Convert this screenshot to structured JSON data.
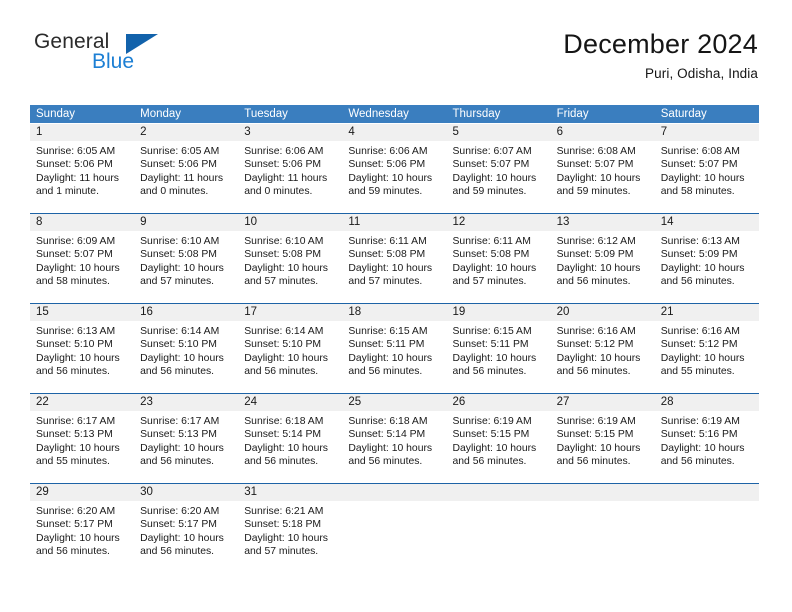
{
  "brand": {
    "name_part1": "General",
    "name_part2": "Blue",
    "triangle_color": "#1262ab",
    "blue_color": "#1c7fd4"
  },
  "header": {
    "month_title": "December 2024",
    "location": "Puri, Odisha, India"
  },
  "theme": {
    "header_blue": "#3a7ebf",
    "separator_blue": "#1d63a6",
    "daynum_band": "#f0f0f0"
  },
  "weekdays": [
    "Sunday",
    "Monday",
    "Tuesday",
    "Wednesday",
    "Thursday",
    "Friday",
    "Saturday"
  ],
  "weeks": [
    [
      {
        "day": "1",
        "sunrise": "Sunrise: 6:05 AM",
        "sunset": "Sunset: 5:06 PM",
        "daylight1": "Daylight: 11 hours",
        "daylight2": "and 1 minute."
      },
      {
        "day": "2",
        "sunrise": "Sunrise: 6:05 AM",
        "sunset": "Sunset: 5:06 PM",
        "daylight1": "Daylight: 11 hours",
        "daylight2": "and 0 minutes."
      },
      {
        "day": "3",
        "sunrise": "Sunrise: 6:06 AM",
        "sunset": "Sunset: 5:06 PM",
        "daylight1": "Daylight: 11 hours",
        "daylight2": "and 0 minutes."
      },
      {
        "day": "4",
        "sunrise": "Sunrise: 6:06 AM",
        "sunset": "Sunset: 5:06 PM",
        "daylight1": "Daylight: 10 hours",
        "daylight2": "and 59 minutes."
      },
      {
        "day": "5",
        "sunrise": "Sunrise: 6:07 AM",
        "sunset": "Sunset: 5:07 PM",
        "daylight1": "Daylight: 10 hours",
        "daylight2": "and 59 minutes."
      },
      {
        "day": "6",
        "sunrise": "Sunrise: 6:08 AM",
        "sunset": "Sunset: 5:07 PM",
        "daylight1": "Daylight: 10 hours",
        "daylight2": "and 59 minutes."
      },
      {
        "day": "7",
        "sunrise": "Sunrise: 6:08 AM",
        "sunset": "Sunset: 5:07 PM",
        "daylight1": "Daylight: 10 hours",
        "daylight2": "and 58 minutes."
      }
    ],
    [
      {
        "day": "8",
        "sunrise": "Sunrise: 6:09 AM",
        "sunset": "Sunset: 5:07 PM",
        "daylight1": "Daylight: 10 hours",
        "daylight2": "and 58 minutes."
      },
      {
        "day": "9",
        "sunrise": "Sunrise: 6:10 AM",
        "sunset": "Sunset: 5:08 PM",
        "daylight1": "Daylight: 10 hours",
        "daylight2": "and 57 minutes."
      },
      {
        "day": "10",
        "sunrise": "Sunrise: 6:10 AM",
        "sunset": "Sunset: 5:08 PM",
        "daylight1": "Daylight: 10 hours",
        "daylight2": "and 57 minutes."
      },
      {
        "day": "11",
        "sunrise": "Sunrise: 6:11 AM",
        "sunset": "Sunset: 5:08 PM",
        "daylight1": "Daylight: 10 hours",
        "daylight2": "and 57 minutes."
      },
      {
        "day": "12",
        "sunrise": "Sunrise: 6:11 AM",
        "sunset": "Sunset: 5:08 PM",
        "daylight1": "Daylight: 10 hours",
        "daylight2": "and 57 minutes."
      },
      {
        "day": "13",
        "sunrise": "Sunrise: 6:12 AM",
        "sunset": "Sunset: 5:09 PM",
        "daylight1": "Daylight: 10 hours",
        "daylight2": "and 56 minutes."
      },
      {
        "day": "14",
        "sunrise": "Sunrise: 6:13 AM",
        "sunset": "Sunset: 5:09 PM",
        "daylight1": "Daylight: 10 hours",
        "daylight2": "and 56 minutes."
      }
    ],
    [
      {
        "day": "15",
        "sunrise": "Sunrise: 6:13 AM",
        "sunset": "Sunset: 5:10 PM",
        "daylight1": "Daylight: 10 hours",
        "daylight2": "and 56 minutes."
      },
      {
        "day": "16",
        "sunrise": "Sunrise: 6:14 AM",
        "sunset": "Sunset: 5:10 PM",
        "daylight1": "Daylight: 10 hours",
        "daylight2": "and 56 minutes."
      },
      {
        "day": "17",
        "sunrise": "Sunrise: 6:14 AM",
        "sunset": "Sunset: 5:10 PM",
        "daylight1": "Daylight: 10 hours",
        "daylight2": "and 56 minutes."
      },
      {
        "day": "18",
        "sunrise": "Sunrise: 6:15 AM",
        "sunset": "Sunset: 5:11 PM",
        "daylight1": "Daylight: 10 hours",
        "daylight2": "and 56 minutes."
      },
      {
        "day": "19",
        "sunrise": "Sunrise: 6:15 AM",
        "sunset": "Sunset: 5:11 PM",
        "daylight1": "Daylight: 10 hours",
        "daylight2": "and 56 minutes."
      },
      {
        "day": "20",
        "sunrise": "Sunrise: 6:16 AM",
        "sunset": "Sunset: 5:12 PM",
        "daylight1": "Daylight: 10 hours",
        "daylight2": "and 56 minutes."
      },
      {
        "day": "21",
        "sunrise": "Sunrise: 6:16 AM",
        "sunset": "Sunset: 5:12 PM",
        "daylight1": "Daylight: 10 hours",
        "daylight2": "and 55 minutes."
      }
    ],
    [
      {
        "day": "22",
        "sunrise": "Sunrise: 6:17 AM",
        "sunset": "Sunset: 5:13 PM",
        "daylight1": "Daylight: 10 hours",
        "daylight2": "and 55 minutes."
      },
      {
        "day": "23",
        "sunrise": "Sunrise: 6:17 AM",
        "sunset": "Sunset: 5:13 PM",
        "daylight1": "Daylight: 10 hours",
        "daylight2": "and 56 minutes."
      },
      {
        "day": "24",
        "sunrise": "Sunrise: 6:18 AM",
        "sunset": "Sunset: 5:14 PM",
        "daylight1": "Daylight: 10 hours",
        "daylight2": "and 56 minutes."
      },
      {
        "day": "25",
        "sunrise": "Sunrise: 6:18 AM",
        "sunset": "Sunset: 5:14 PM",
        "daylight1": "Daylight: 10 hours",
        "daylight2": "and 56 minutes."
      },
      {
        "day": "26",
        "sunrise": "Sunrise: 6:19 AM",
        "sunset": "Sunset: 5:15 PM",
        "daylight1": "Daylight: 10 hours",
        "daylight2": "and 56 minutes."
      },
      {
        "day": "27",
        "sunrise": "Sunrise: 6:19 AM",
        "sunset": "Sunset: 5:15 PM",
        "daylight1": "Daylight: 10 hours",
        "daylight2": "and 56 minutes."
      },
      {
        "day": "28",
        "sunrise": "Sunrise: 6:19 AM",
        "sunset": "Sunset: 5:16 PM",
        "daylight1": "Daylight: 10 hours",
        "daylight2": "and 56 minutes."
      }
    ],
    [
      {
        "day": "29",
        "sunrise": "Sunrise: 6:20 AM",
        "sunset": "Sunset: 5:17 PM",
        "daylight1": "Daylight: 10 hours",
        "daylight2": "and 56 minutes."
      },
      {
        "day": "30",
        "sunrise": "Sunrise: 6:20 AM",
        "sunset": "Sunset: 5:17 PM",
        "daylight1": "Daylight: 10 hours",
        "daylight2": "and 56 minutes."
      },
      {
        "day": "31",
        "sunrise": "Sunrise: 6:21 AM",
        "sunset": "Sunset: 5:18 PM",
        "daylight1": "Daylight: 10 hours",
        "daylight2": "and 57 minutes."
      },
      {
        "day": "",
        "sunrise": "",
        "sunset": "",
        "daylight1": "",
        "daylight2": ""
      },
      {
        "day": "",
        "sunrise": "",
        "sunset": "",
        "daylight1": "",
        "daylight2": ""
      },
      {
        "day": "",
        "sunrise": "",
        "sunset": "",
        "daylight1": "",
        "daylight2": ""
      },
      {
        "day": "",
        "sunrise": "",
        "sunset": "",
        "daylight1": "",
        "daylight2": ""
      }
    ]
  ]
}
